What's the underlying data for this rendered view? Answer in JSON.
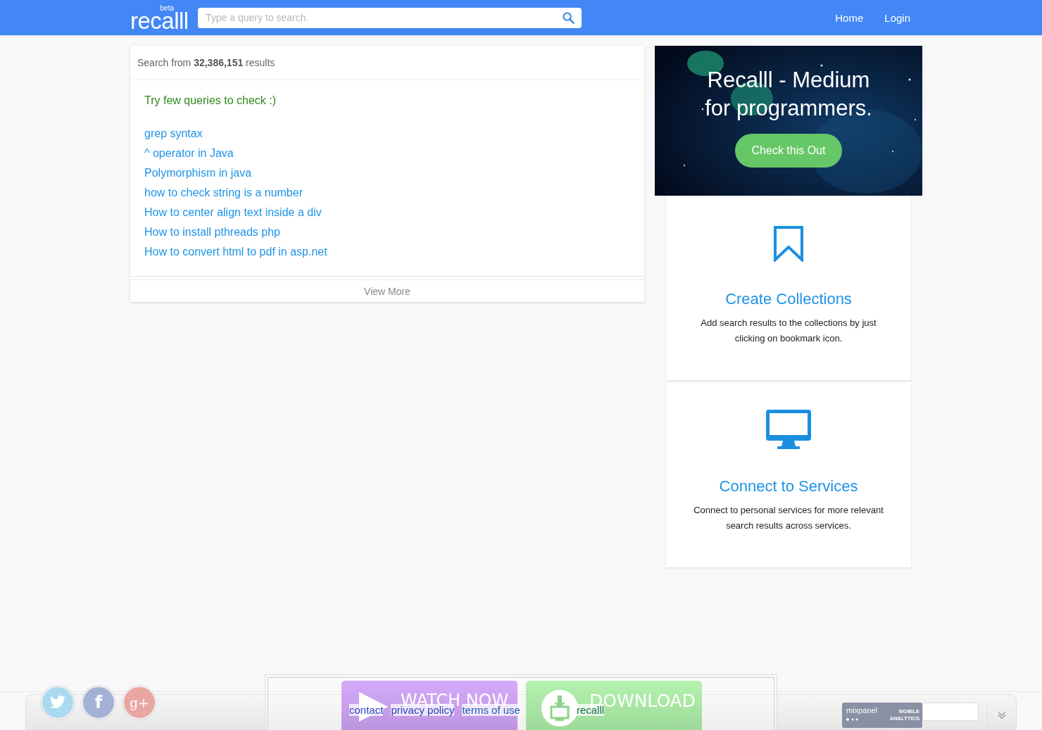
{
  "header": {
    "logo": "recalll",
    "logo_badge": "beta",
    "search": {
      "placeholder": "Type a query to search."
    },
    "nav": [
      {
        "label": "Home"
      },
      {
        "label": "Login"
      }
    ]
  },
  "results": {
    "summary": "Search from **32,386,151** results",
    "heading": "Try few queries to check :)",
    "queries": [
      "grep syntax",
      "^ operator in Java",
      "Polymorphism in java",
      "how to check string is a number",
      "How to center align text inside a div",
      "How to install pthreads php",
      "How to convert html to pdf in asp.net"
    ],
    "more": "View More"
  },
  "promo": {
    "title_lines": [
      "Recalll - Medium",
      "for programmers."
    ],
    "button": "Check this Out"
  },
  "features": [
    {
      "kind": "bookmark",
      "title": "Create Collections",
      "text": "Add search results to the collections by just clicking on bookmark icon."
    },
    {
      "kind": "monitor",
      "title": "Connect to Services",
      "text": "Connect to personal services for more relevant search results across services."
    }
  ],
  "footer": {
    "social": [
      {
        "kind": "twitter"
      },
      {
        "kind": "facebook",
        "label": "f"
      },
      {
        "kind": "gplus",
        "label": "g+"
      }
    ],
    "links": [
      "contact",
      "privacy policy",
      "terms of use",
      "recalll"
    ],
    "badge": {
      "brand": "mixpanel",
      "tagline_lines": [
        "MOBILE",
        "ANALYTICS"
      ]
    }
  },
  "ad": {
    "buttons": [
      {
        "kind": "watch",
        "label": "WATCH NOW"
      },
      {
        "kind": "download",
        "label": "DOWNLOAD"
      }
    ]
  }
}
